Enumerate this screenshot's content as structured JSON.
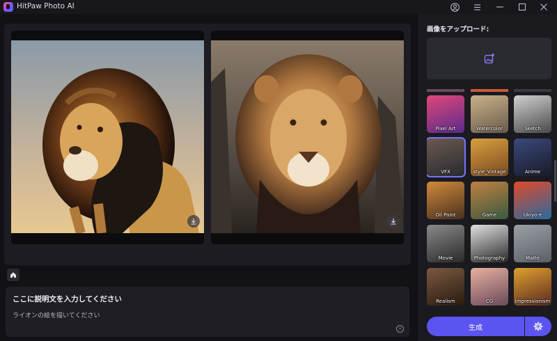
{
  "titlebar": {
    "app_title": "HitPaw Photo AI",
    "icons": [
      "user-icon",
      "menu-icon",
      "minimize-icon",
      "maximize-icon",
      "close-icon"
    ]
  },
  "preview": {
    "images": [
      {
        "name": "generated-lion-1",
        "download_icon": "download-icon"
      },
      {
        "name": "generated-lion-2",
        "download_icon": "download-icon"
      }
    ]
  },
  "prompt": {
    "title": "ここに説明文を入力してください",
    "value": "ライオンの絵を描いてください",
    "clear_icon": "clear-icon"
  },
  "sidebar": {
    "upload_label": "画像をアップロード:",
    "upload_icon": "add-image-icon",
    "styles": [
      {
        "label": "Pixel Art",
        "colors": [
          "#e0487a",
          "#5a2a8a"
        ],
        "selected": false
      },
      {
        "label": "Watercolor",
        "colors": [
          "#c9b28a",
          "#6a5a4a"
        ],
        "selected": false
      },
      {
        "label": "Sketch",
        "colors": [
          "#d0d0d0",
          "#4a4a4a"
        ],
        "selected": false
      },
      {
        "label": "VFX",
        "colors": [
          "#6a5a50",
          "#2a2a30"
        ],
        "selected": true
      },
      {
        "label": "style_Vintage",
        "colors": [
          "#d8a040",
          "#7a4a20"
        ],
        "selected": false
      },
      {
        "label": "Anime",
        "colors": [
          "#3a4a7a",
          "#1a1a2a"
        ],
        "selected": false
      },
      {
        "label": "Oil Paint",
        "colors": [
          "#d08a3a",
          "#4a3020"
        ],
        "selected": false
      },
      {
        "label": "Game",
        "colors": [
          "#c08040",
          "#3a5a40"
        ],
        "selected": false
      },
      {
        "label": "Ukiyo-e",
        "colors": [
          "#e04a2a",
          "#2a6aa0"
        ],
        "selected": false
      },
      {
        "label": "Movie",
        "colors": [
          "#8a8a8a",
          "#2a2a2a"
        ],
        "selected": false
      },
      {
        "label": "Photography",
        "colors": [
          "#e0e0e0",
          "#2a2a2a"
        ],
        "selected": false
      },
      {
        "label": "Matte",
        "colors": [
          "#9aa0a6",
          "#5a6066"
        ],
        "selected": false
      },
      {
        "label": "Realism",
        "colors": [
          "#7a5a40",
          "#2a1a10"
        ],
        "selected": false
      },
      {
        "label": "CG",
        "colors": [
          "#e8b0a0",
          "#6a4a5a"
        ],
        "selected": false
      },
      {
        "label": "Impressionism",
        "colors": [
          "#e0a030",
          "#5a2a20"
        ],
        "selected": false
      }
    ],
    "generate_label": "生成",
    "settings_icon": "gear-icon"
  },
  "colors": {
    "accent": "#5b54f0",
    "selected_outline": "#7a72ff",
    "background": "#121216",
    "panel": "#1c1c22"
  }
}
